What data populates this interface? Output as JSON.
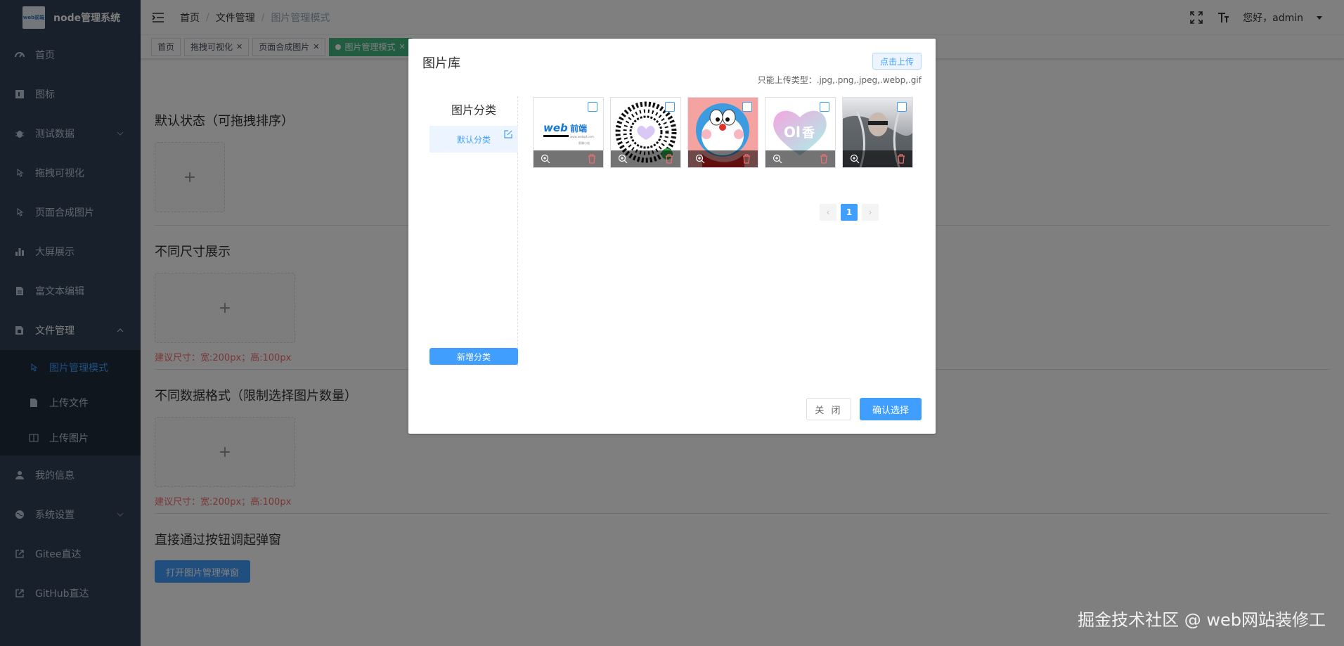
{
  "app": {
    "title": "node管理系统",
    "logo_text": "web前端"
  },
  "sidebar": {
    "items": [
      {
        "label": "首页",
        "icon": "dashboard-icon"
      },
      {
        "label": "图标",
        "icon": "icon-box-icon"
      },
      {
        "label": "测试数据",
        "icon": "bug-icon",
        "expandable": true
      },
      {
        "label": "拖拽可视化",
        "icon": "drag-icon"
      },
      {
        "label": "页面合成图片",
        "icon": "compose-icon"
      },
      {
        "label": "大屏展示",
        "icon": "chart-icon"
      },
      {
        "label": "富文本编辑",
        "icon": "document-icon"
      },
      {
        "label": "文件管理",
        "icon": "file-icon",
        "expanded": true
      },
      {
        "label": "我的信息",
        "icon": "user-icon"
      },
      {
        "label": "系统设置",
        "icon": "globe-icon",
        "expandable": true
      },
      {
        "label": "Gitee直达",
        "icon": "external-link-icon"
      },
      {
        "label": "GitHub直达",
        "icon": "external-link-icon"
      }
    ],
    "file_submenu": [
      {
        "label": "图片管理模式",
        "active": true
      },
      {
        "label": "上传文件"
      },
      {
        "label": "上传图片"
      }
    ]
  },
  "navbar": {
    "breadcrumb": [
      "首页",
      "文件管理",
      "图片管理模式"
    ],
    "greeting": "您好，admin"
  },
  "tags": [
    {
      "label": "首页",
      "closable": false
    },
    {
      "label": "拖拽可视化",
      "closable": true
    },
    {
      "label": "页面合成图片",
      "closable": true
    },
    {
      "label": "图片管理模式",
      "closable": true,
      "active": true
    }
  ],
  "content": {
    "section1": "默认状态（可拖拽排序）",
    "section2": "不同尺寸展示",
    "size_tip": "建议尺寸：宽:200px；高:100px",
    "section3": "不同数据格式（限制选择图片数量）",
    "section4": "直接通过按钮调起弹窗",
    "open_button": "打开图片管理弹窗"
  },
  "dialog": {
    "title": "图片库",
    "upload_button": "点击上传",
    "upload_tip": "只能上传类型：.jpg,.png,.jpeg,.webp,.gif",
    "category_title": "图片分类",
    "category_default": "默认分类",
    "add_category": "新增分类",
    "images": [
      {
        "name": "web-brand-image"
      },
      {
        "name": "qr-code-image"
      },
      {
        "name": "doraemon-image"
      },
      {
        "name": "heart-logo-image"
      },
      {
        "name": "portrait-image"
      }
    ],
    "pagination": {
      "current": "1",
      "prev": "‹",
      "next": "›"
    },
    "close_button": "关 闭",
    "confirm_button": "确认选择"
  },
  "watermark": "掘金技术社区 @ web网站装修工",
  "colors": {
    "sidebar_bg": "#304156",
    "primary": "#409eff",
    "danger": "#f56c6c",
    "tag_active": "#42b983"
  }
}
